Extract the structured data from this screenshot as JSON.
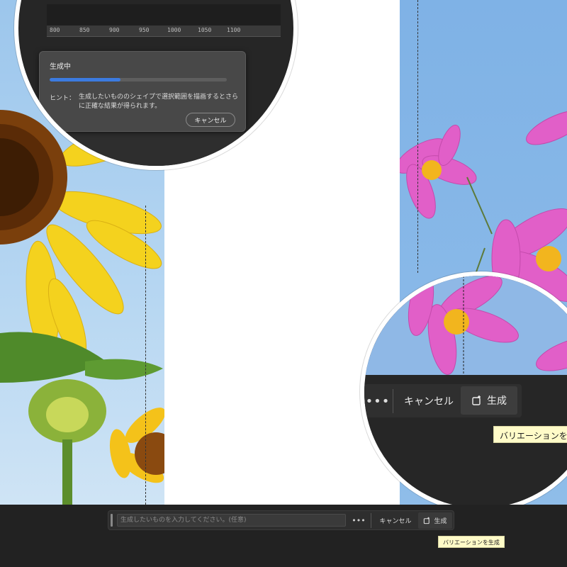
{
  "canvas": {
    "ruler": {
      "ticks": [
        "800",
        "850",
        "900",
        "950",
        "1000",
        "1050",
        "1100"
      ]
    },
    "tab_dots": "..."
  },
  "progress_dialog": {
    "title": "生成中",
    "progress": 0.4,
    "hint_label": "ヒント：",
    "hint_text": "生成したいもののシェイプで選択範囲を描画するとさらに正確な結果が得られます。",
    "cancel_label": "キャンセル"
  },
  "zoomed_taskbar": {
    "more_label": "•••",
    "cancel_label": "キャンセル",
    "generate_label": "生成",
    "tooltip": "バリエーションを"
  },
  "taskbar": {
    "prompt_placeholder": "生成したいものを入力してください。(任意)",
    "more_label": "•••",
    "cancel_label": "キャンセル",
    "generate_label": "生成",
    "tooltip": "バリエーションを生成"
  },
  "colors": {
    "accent": "#3c7be0",
    "panel": "#2e2e2e",
    "tooltip_bg": "#fffbc8",
    "sunflower": "#f4d21e",
    "cosmos": "#e15fc8"
  },
  "icons": [
    "generate-icon",
    "more-icon",
    "grip-icon",
    "sunflower-image",
    "cosmos-image"
  ]
}
